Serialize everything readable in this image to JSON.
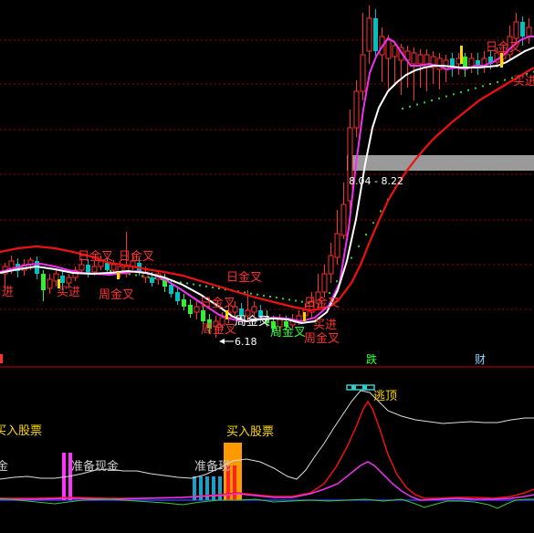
{
  "main_chart": {
    "cross_labels": {
      "day_cross": "日金叉",
      "week_cross": "周金叉",
      "buy_point": "买进"
    },
    "labels_top": [
      {
        "text": "日金叉",
        "color": "#ff3030"
      },
      {
        "text": "日金叉",
        "color": "#ff3030"
      },
      {
        "text": "日金叉",
        "color": "#ff3030"
      },
      {
        "text": "日金叉",
        "color": "#ff3030"
      },
      {
        "text": "日金叉",
        "color": "#ff3030"
      }
    ],
    "labels_bottom": [
      {
        "text": "周金叉",
        "color": "#ff3030"
      },
      {
        "text": "周金叉",
        "color": "#ff3030"
      },
      {
        "text": "周金叉",
        "color": "#ffffff"
      },
      {
        "text": "周金叉",
        "color": "#33ff33"
      },
      {
        "text": "周金叉",
        "color": "#ff3030"
      },
      {
        "text": "买进",
        "color": "#ff3030"
      },
      {
        "text": "买进",
        "color": "#ff3030"
      },
      {
        "text": "买进",
        "color": "#ff3030"
      }
    ],
    "low_marker": "6.18",
    "price_range_box": "8.04 - 8.22",
    "tag_die": "跌",
    "tag_cai": "财"
  },
  "indicator_panel": {
    "escape_top": "逃顶",
    "buy_stock": "买入股票",
    "buy_stock_left": "买入股票",
    "prepare_cash": "准备现金",
    "prepare_partial": "准备现",
    "cash_partial": "金"
  },
  "colors": {
    "up_candle": "#ff3030",
    "down_candle": "#00c0c0",
    "down_candle_green": "#33ee33",
    "ma_white": "#ffffff",
    "ma_magenta": "#ee33ee",
    "ma_red": "#ee1111",
    "grid": "#b00000",
    "dots": "#33cc33",
    "label_red": "#ff3030",
    "label_yellow": "#ffd700",
    "bar_magenta": "#ff33ff",
    "bar_cyan": "#1aa0c8",
    "bar_orange": "#ff9900",
    "bar_red": "#ff2020"
  }
}
